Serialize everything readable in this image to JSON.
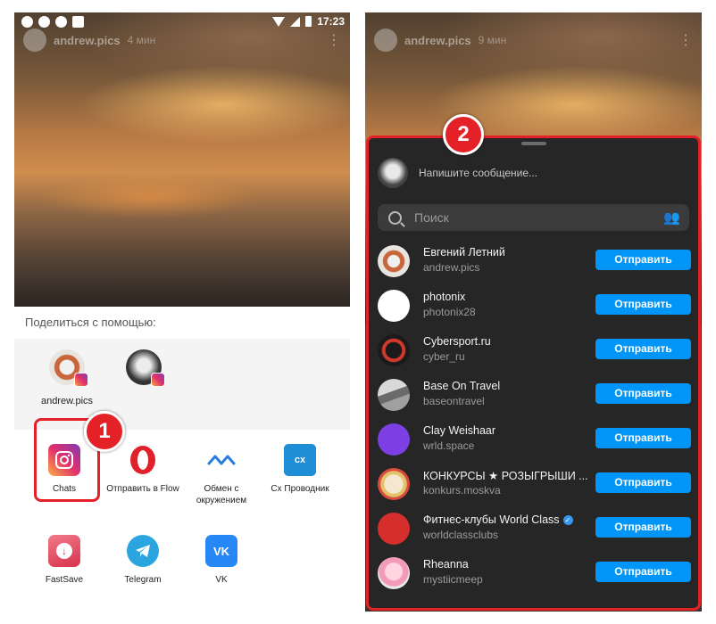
{
  "status": {
    "time": "17:23"
  },
  "left": {
    "story": {
      "username": "andrew.pics",
      "time": "4 мин"
    },
    "share_title": "Поделиться с помощью:",
    "direct_targets": [
      {
        "label": "andrew.pics"
      },
      {
        "label": ""
      }
    ],
    "apps": [
      {
        "label": "Chats",
        "icon": "instagram-icon"
      },
      {
        "label": "Отправить в Flow",
        "icon": "opera-icon"
      },
      {
        "label": "Обмен с окружением",
        "icon": "nearby-share-icon"
      },
      {
        "label": "Cx Проводник",
        "icon": "cx-folder-icon"
      },
      {
        "label": "FastSave",
        "icon": "fastsave-icon"
      },
      {
        "label": "Telegram",
        "icon": "telegram-icon"
      },
      {
        "label": "VK",
        "icon": "vk-icon"
      }
    ],
    "step_badge": "1"
  },
  "right": {
    "story": {
      "username": "andrew.pics",
      "time": "9 мин"
    },
    "step_badge": "2",
    "message_placeholder": "Напишите сообщение...",
    "search_placeholder": "Поиск",
    "contacts": [
      {
        "name": "Евгений Летний",
        "username": "andrew.pics",
        "button": "Отправить",
        "verified": false
      },
      {
        "name": "photonix",
        "username": "photonix28",
        "button": "Отправить",
        "verified": false
      },
      {
        "name": "Cybersport.ru",
        "username": "cyber_ru",
        "button": "Отправить",
        "verified": false
      },
      {
        "name": "Base On Travel",
        "username": "baseontravel",
        "button": "Отправить",
        "verified": false
      },
      {
        "name": "Clay Weishaar",
        "username": "wrld.space",
        "button": "Отправить",
        "verified": false
      },
      {
        "name": "КОНКУРСЫ ★ РОЗЫГРЫШИ ...",
        "username": "konkurs.moskva",
        "button": "Отправить",
        "verified": false
      },
      {
        "name": "Фитнес-клубы World Class",
        "username": "worldclassclubs",
        "button": "Отправить",
        "verified": true
      },
      {
        "name": "Rheanna",
        "username": "mystiicmeep",
        "button": "Отправить",
        "verified": false
      }
    ]
  },
  "colors": {
    "accent_red": "#e32126",
    "send_blue": "#0095f6",
    "sheet_bg": "#262626"
  }
}
